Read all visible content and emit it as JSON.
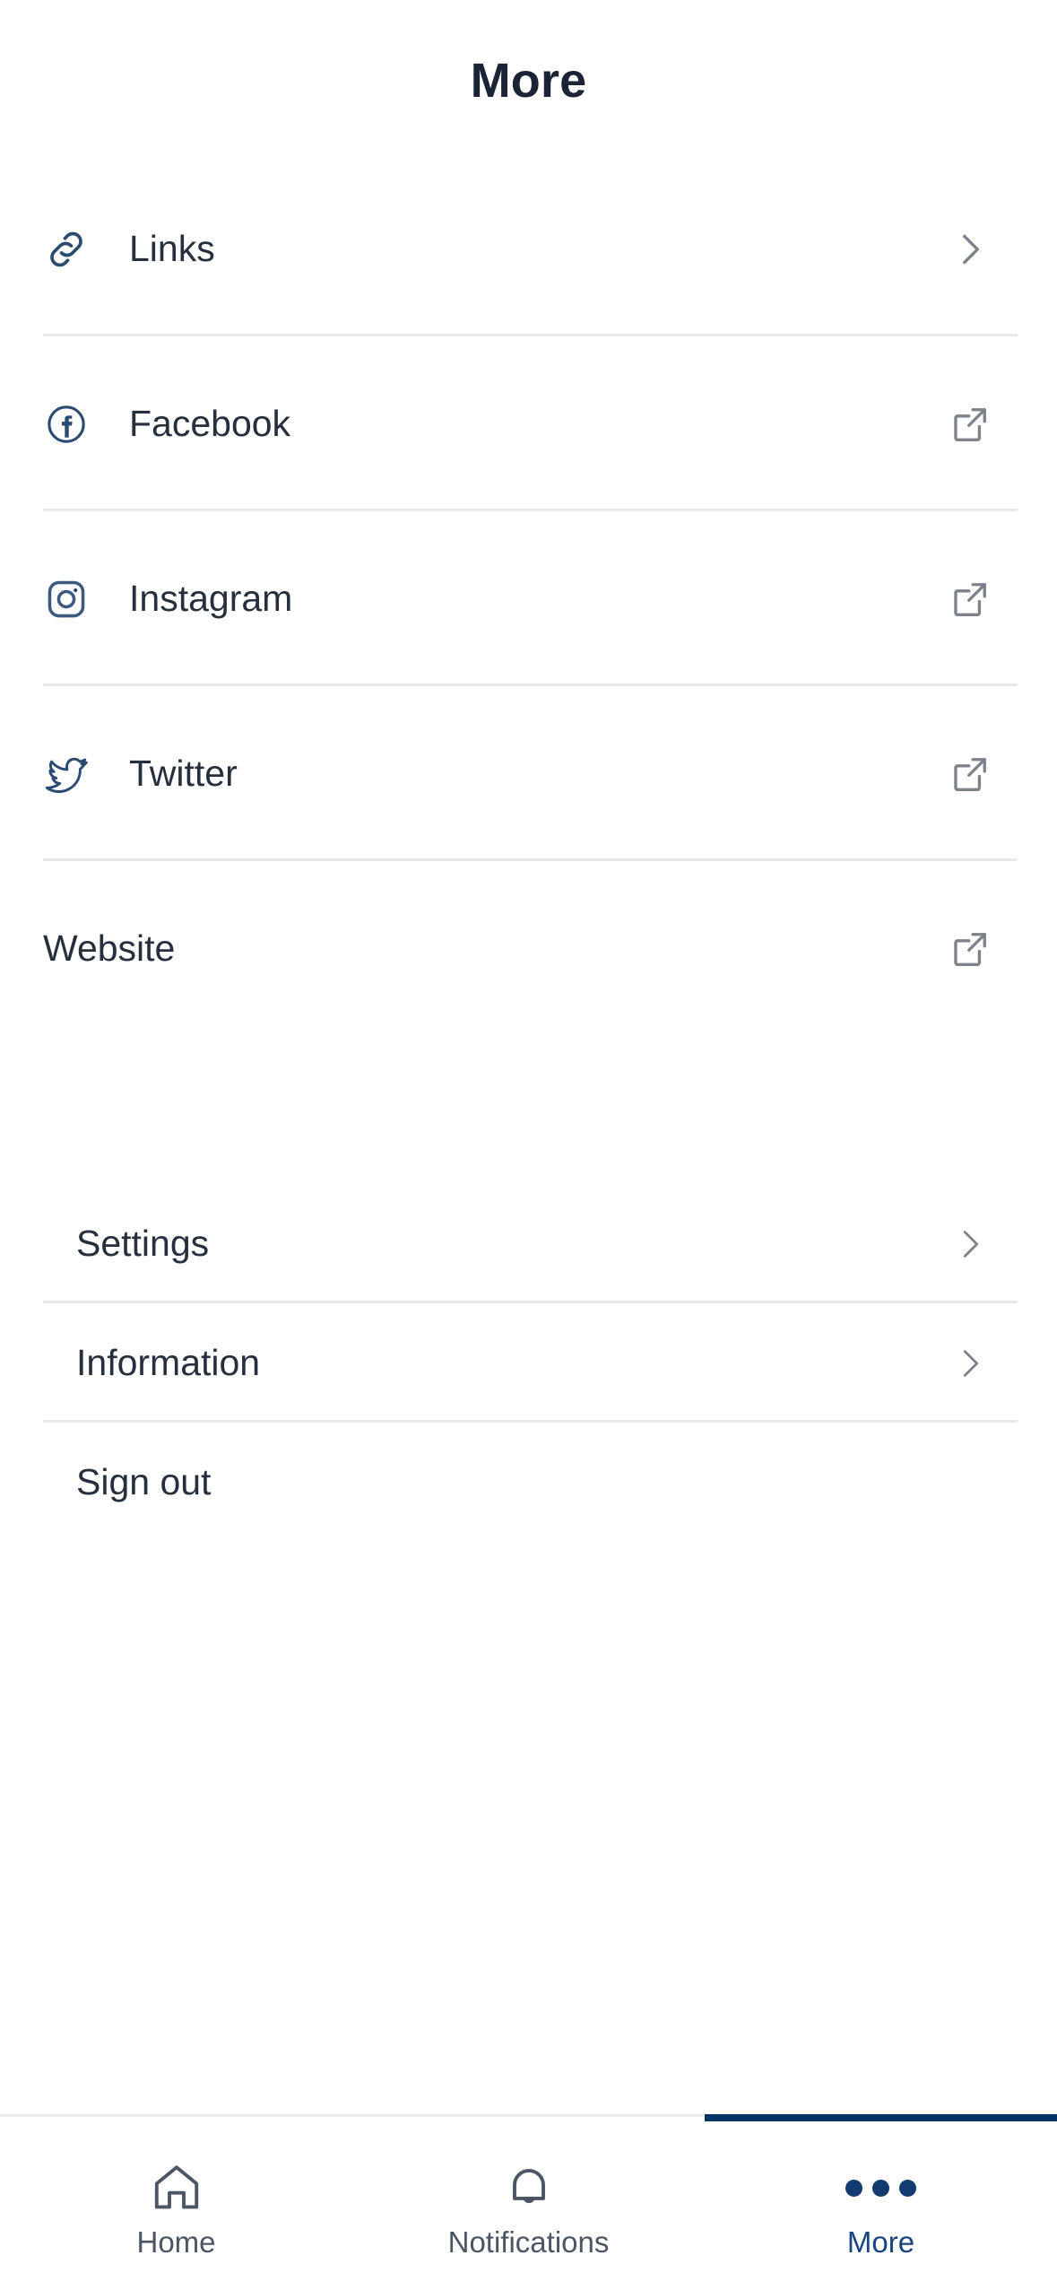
{
  "header": {
    "title": "More"
  },
  "colors": {
    "accent_navy": "#003366",
    "nav_active_label": "#17457f",
    "icon_navy": "#2b4a6f",
    "label_text": "#262f3d",
    "chevron_gray": "#7d818c",
    "divider": "#e7e8ea"
  },
  "social_group": {
    "items": [
      {
        "label": "Links",
        "icon": "link-chain-icon",
        "action_icon": "chevron-right-icon",
        "has_icon": true
      },
      {
        "label": "Facebook",
        "icon": "facebook-icon",
        "action_icon": "external-link-icon",
        "has_icon": true
      },
      {
        "label": "Instagram",
        "icon": "instagram-icon",
        "action_icon": "external-link-icon",
        "has_icon": true
      },
      {
        "label": "Twitter",
        "icon": "twitter-bird-icon",
        "action_icon": "external-link-icon",
        "has_icon": true
      },
      {
        "label": "Website",
        "icon": "",
        "action_icon": "external-link-icon",
        "has_icon": false
      }
    ]
  },
  "account_group": {
    "items": [
      {
        "label": "Settings",
        "action_icon": "chevron-right-icon"
      },
      {
        "label": "Information",
        "action_icon": "chevron-right-icon"
      },
      {
        "label": "Sign out",
        "action_icon": ""
      }
    ]
  },
  "bottom_nav": {
    "items": [
      {
        "label": "Home",
        "icon": "home-icon",
        "active": false
      },
      {
        "label": "Notifications",
        "icon": "bell-icon",
        "active": false
      },
      {
        "label": "More",
        "icon": "three-dots-icon",
        "active": true
      }
    ]
  }
}
